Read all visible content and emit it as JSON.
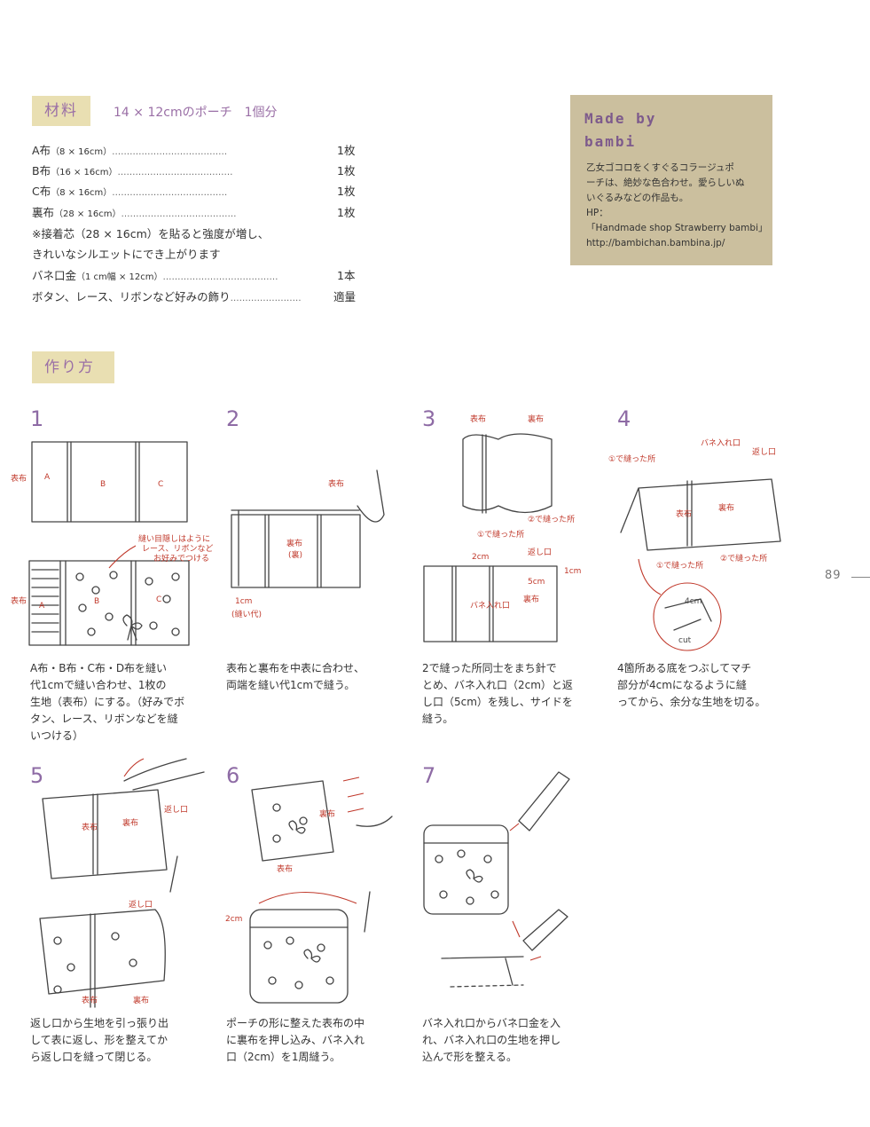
{
  "materials": {
    "heading": "材料",
    "subtitle": "14 × 12cmのポーチ　1個分",
    "rows": [
      {
        "name": "A布",
        "size": "（8 × 16cm）",
        "qty": "1枚"
      },
      {
        "name": "B布",
        "size": "（16 × 16cm）",
        "qty": "1枚"
      },
      {
        "name": "C布",
        "size": "（8 × 16cm）",
        "qty": "1枚"
      },
      {
        "name": "裏布",
        "size": "（28 × 16cm）",
        "qty": "1枚"
      }
    ],
    "note_line1": "※接着芯（28 × 16cm）を貼ると強度が増し、",
    "note_line2": "きれいなシルエットにでき上がります",
    "clasp": {
      "name": "バネ口金",
      "size": "（1 cm幅 × 12cm）",
      "qty": "1本"
    },
    "deco": {
      "name": "ボタン、レース、リボンなど好みの飾り",
      "qty": "適量"
    },
    "dots": "…………………………………"
  },
  "profile": {
    "brand_line1": "Made by",
    "brand_line2": "bambi",
    "desc1": "乙女ゴコロをくすぐるコラージュポ",
    "desc2": "ーチは、絶妙な色合わせ。愛らしいぬ",
    "desc3": "いぐるみなどの作品も。",
    "desc4": "HP：",
    "desc5": "「Handmade shop Strawberry bambi」",
    "desc6": "http://bambichan.bambina.jp/"
  },
  "howto": {
    "heading": "作り方"
  },
  "steps": [
    {
      "num": "1",
      "lines": [
        "A布・B布・C布・D布を縫い",
        "代1cmで縫い合わせ、1枚の",
        "生地（表布）にする。（好みでボ",
        "タン、レース、リボンなどを縫",
        "いつける）"
      ]
    },
    {
      "num": "2",
      "lines": [
        "表布と裏布を中表に合わせ、",
        "両端を縫い代1cmで縫う。"
      ]
    },
    {
      "num": "3",
      "lines": [
        "2で縫った所同士をまち針で",
        "とめ、バネ入れ口（2cm）と返",
        "し口（5cm）を残し、サイドを",
        "縫う。"
      ]
    },
    {
      "num": "4",
      "lines": [
        "4箇所ある底をつぶしてマチ",
        "部分が4cmになるように縫",
        "ってから、余分な生地を切る。"
      ]
    },
    {
      "num": "5",
      "lines": [
        "返し口から生地を引っ張り出",
        "して表に返し、形を整えてか",
        "ら返し口を縫って閉じる。"
      ]
    },
    {
      "num": "6",
      "lines": [
        "ポーチの形に整えた表布の中",
        "に裏布を押し込み、バネ入れ",
        "口（2cm）を1周縫う。"
      ]
    },
    {
      "num": "7",
      "lines": [
        "バネ入れ口からバネ口金を入",
        "れ、バネ入れ口の生地を押し",
        "込んで形を整える。"
      ]
    }
  ],
  "sketch_labels": {
    "omote": "表布",
    "ura": "裏布",
    "omote_paren": "(裏)",
    "a": "A",
    "b": "B",
    "c": "C",
    "cm1": "1cm",
    "cm2": "2cm",
    "cm4": "4cm",
    "cm5": "5cm",
    "kaeshi": "返し口",
    "cut": "cut",
    "note1": "縫い目隠しはように",
    "note2": "レース、リボンなどを",
    "note3": "お好みでつける",
    "sewn1": "①で縫った所",
    "sewn2": "②で縫った所",
    "bane": "バネ入れ口",
    "nuishiro": "(縫い代)"
  },
  "page_number": "89"
}
